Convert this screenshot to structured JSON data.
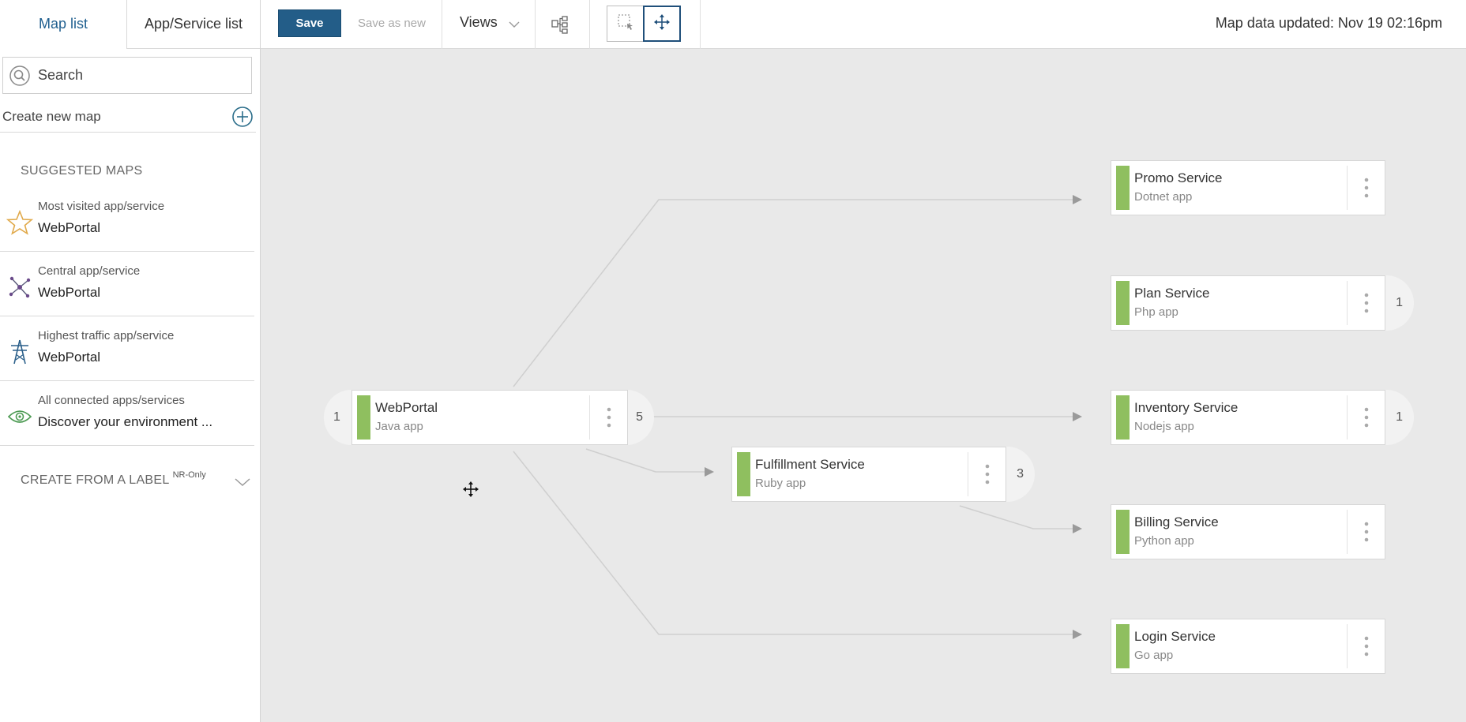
{
  "sidebar": {
    "tabs": [
      {
        "label": "Map list"
      },
      {
        "label": "App/Service list"
      }
    ],
    "search": {
      "placeholder": "Search",
      "value": ""
    },
    "create_map_label": "Create new map",
    "suggested_title": "SUGGESTED MAPS",
    "suggested": [
      {
        "icon": "star-icon",
        "small": "Most visited app/service",
        "big": "WebPortal"
      },
      {
        "icon": "network-hub-icon",
        "small": "Central app/service",
        "big": "WebPortal"
      },
      {
        "icon": "power-tower-icon",
        "small": "Highest traffic app/service",
        "big": "WebPortal"
      },
      {
        "icon": "eye-icon",
        "small": "All connected apps/services",
        "big": "Discover your environment  ..."
      }
    ],
    "create_from_label": "CREATE FROM A LABEL",
    "create_from_label_badge": "NR-Only"
  },
  "toolbar": {
    "save_label": "Save",
    "save_as_new_label": "Save as new",
    "views_label": "Views",
    "updated_text": "Map data updated: Nov 19 02:16pm"
  },
  "map": {
    "center": {
      "name": "WebPortal",
      "type": "Java app",
      "left_count": "1",
      "right_count": "5"
    },
    "nodes": [
      {
        "name": "Promo Service",
        "type": "Dotnet app"
      },
      {
        "name": "Plan Service",
        "type": "Php app",
        "count": "1"
      },
      {
        "name": "Inventory Service",
        "type": "Nodejs app",
        "count": "1"
      },
      {
        "name": "Fulfillment Service",
        "type": "Ruby app",
        "count": "3"
      },
      {
        "name": "Billing Service",
        "type": "Python app"
      },
      {
        "name": "Login Service",
        "type": "Go app"
      }
    ]
  },
  "colors": {
    "accent": "#235d88",
    "status_bar": "#8fbf5f",
    "canvas_bg": "#e9e9e9"
  }
}
